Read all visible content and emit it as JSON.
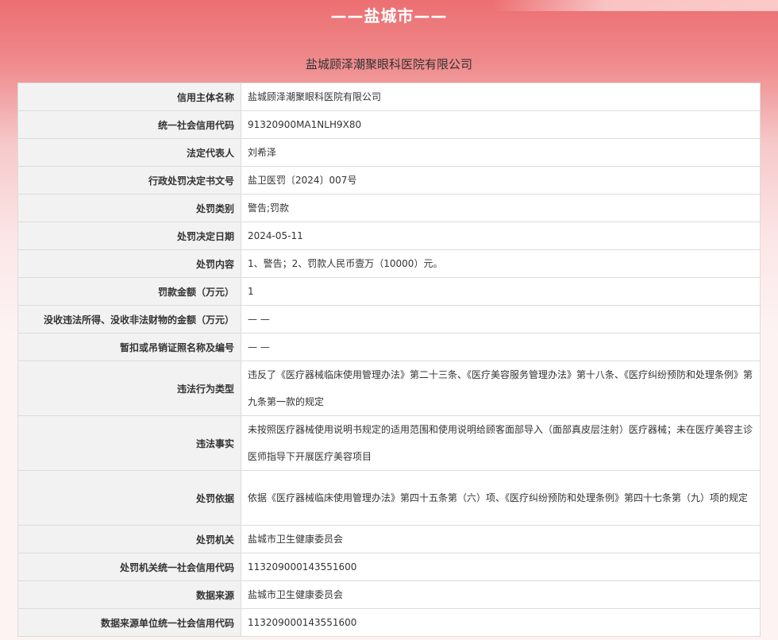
{
  "header": {
    "city_title": "——盐城市——",
    "company_title": "盐城顾泽潮聚眼科医院有限公司"
  },
  "rows": [
    {
      "label": "信用主体名称",
      "value": "盐城顾泽潮聚眼科医院有限公司"
    },
    {
      "label": "统一社会信用代码",
      "value": "91320900MA1NLH9X80"
    },
    {
      "label": "法定代表人",
      "value": "刘希泽"
    },
    {
      "label": "行政处罚决定书文号",
      "value": "盐卫医罚〔2024〕007号"
    },
    {
      "label": "处罚类别",
      "value": "警告;罚款"
    },
    {
      "label": "处罚决定日期",
      "value": "2024-05-11"
    },
    {
      "label": "处罚内容",
      "value": "1、警告；2、罚款人民币壹万（10000）元。"
    },
    {
      "label": "罚款金额（万元）",
      "value": "1"
    },
    {
      "label": "没收违法所得、没收非法财物的金额（万元）",
      "value": "— —"
    },
    {
      "label": "暂扣或吊销证照名称及编号",
      "value": "— —"
    },
    {
      "label": "违法行为类型",
      "value": "违反了《医疗器械临床使用管理办法》第二十三条、《医疗美容服务管理办法》第十八条、《医疗纠纷预防和处理条例》第九条第一款的规定"
    },
    {
      "label": "违法事实",
      "value": "未按照医疗器械使用说明书规定的适用范围和使用说明给顾客面部导入（面部真皮层注射）医疗器械；未在医疗美容主诊医师指导下开展医疗美容项目"
    },
    {
      "label": "处罚依据",
      "value": "依据《医疗器械临床使用管理办法》第四十五条第（六）项、《医疗纠纷预防和处理条例》第四十七条第（九）项的规定"
    },
    {
      "label": "处罚机关",
      "value": "盐城市卫生健康委员会"
    },
    {
      "label": "处罚机关统一社会信用代码",
      "value": "113209000143551600"
    },
    {
      "label": "数据来源",
      "value": "盐城市卫生健康委员会"
    },
    {
      "label": "数据来源单位统一社会信用代码",
      "value": "113209000143551600"
    }
  ]
}
